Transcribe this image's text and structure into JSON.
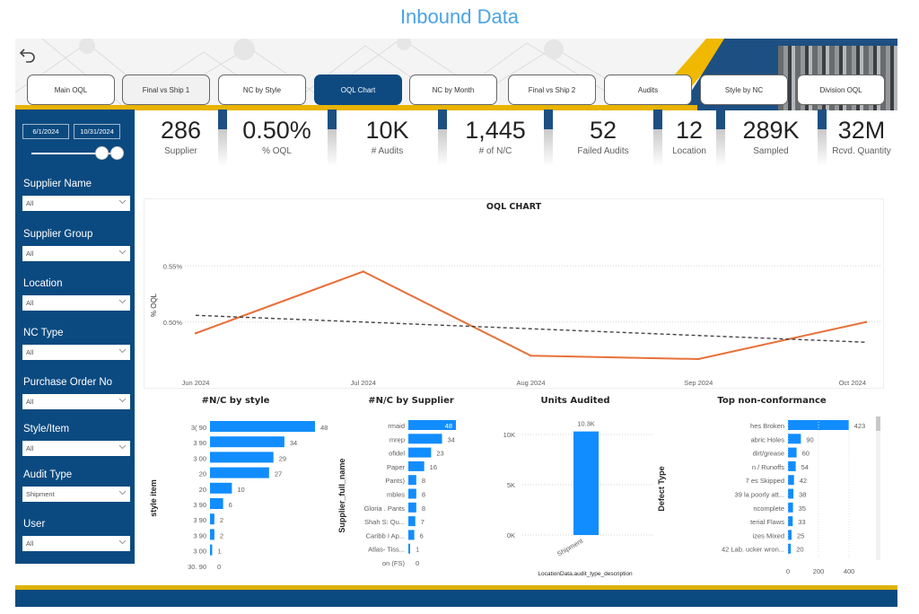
{
  "page": {
    "title": "Inbound Data"
  },
  "nav": {
    "back_icon": "undo-arrow-icon",
    "tabs": [
      {
        "label": "Main OQL",
        "state": "normal"
      },
      {
        "label": "Final vs Ship 1",
        "state": "alt"
      },
      {
        "label": "NC by Style",
        "state": "normal"
      },
      {
        "label": "OQL Chart",
        "state": "active"
      },
      {
        "label": "NC by Month",
        "state": "normal"
      },
      {
        "label": "Final vs Ship 2",
        "state": "normal"
      },
      {
        "label": "Audits",
        "state": "normal"
      },
      {
        "label": "Style by NC",
        "state": "normal"
      },
      {
        "label": "Division OQL",
        "state": "normal"
      }
    ]
  },
  "sidebar": {
    "date_range": {
      "start": "6/1/2024",
      "end": "10/31/2024"
    },
    "filters": [
      {
        "label": "Supplier Name",
        "value": "All"
      },
      {
        "label": "Supplier Group",
        "value": "All"
      },
      {
        "label": "Location",
        "value": "All"
      },
      {
        "label": "NC Type",
        "value": "All"
      },
      {
        "label": "Purchase Order No",
        "value": "All"
      },
      {
        "label": "Style/Item",
        "value": "All"
      },
      {
        "label": "Audit Type",
        "value": "Shipment"
      },
      {
        "label": "User",
        "value": "All"
      }
    ]
  },
  "kpis": [
    {
      "value": "286",
      "label": "Supplier"
    },
    {
      "value": "0.50%",
      "label": "% OQL"
    },
    {
      "value": "10K",
      "label": "# Audits"
    },
    {
      "value": "1,445",
      "label": "# of N/C"
    },
    {
      "value": "52",
      "label": "Failed Audits"
    },
    {
      "value": "12",
      "label": "Location"
    },
    {
      "value": "289K",
      "label": "Sampled"
    },
    {
      "value": "32M",
      "label": "Rcvd. Quantity"
    }
  ],
  "colors": {
    "accent_blue": "#0b4a80",
    "bar_blue": "#118dff",
    "line_orange": "#e8703a",
    "title_blue": "#4aa3e6",
    "yellow": "#e9b300"
  },
  "chart_data": [
    {
      "type": "line",
      "title": "OQL CHART",
      "xlabel": "",
      "ylabel": "% OQL",
      "categories": [
        "Jun 2024",
        "Jul 2024",
        "Aug 2024",
        "Sep 2024",
        "Oct 2024"
      ],
      "series": [
        {
          "name": "% OQL",
          "values": [
            0.49,
            0.545,
            0.47,
            0.467,
            0.5
          ]
        },
        {
          "name": "Trend",
          "style": "dashed",
          "values": [
            0.506,
            0.5,
            0.494,
            0.488,
            0.482
          ]
        }
      ],
      "yticks": [
        "0.55%",
        "0.50%"
      ],
      "ytick_values": [
        0.55,
        0.5
      ],
      "ylim": [
        0.455,
        0.575
      ],
      "grid": true
    },
    {
      "type": "bar",
      "orientation": "horizontal",
      "title": "#N/C by style",
      "ylabel": "style item",
      "categories": [
        "3( 90",
        "3 90",
        "3 00",
        "20",
        "20",
        "3 90",
        "3 90",
        "3 90",
        "3 00",
        "30. 90"
      ],
      "values": [
        48,
        34,
        29,
        27,
        10,
        6,
        2,
        2,
        1,
        0
      ],
      "xlim": [
        0,
        48
      ]
    },
    {
      "type": "bar",
      "orientation": "horizontal",
      "title": "#N/C by Supplier",
      "ylabel": "Supplier_full_name",
      "categories": [
        "rmaid",
        "mrep",
        "ofidel",
        "Paper",
        "Pants)",
        "mbles",
        "Gloria . Pants",
        "Shah S: Qu...",
        "Caribb I Ap...",
        "Atlas- Tiss...",
        "on (FS)"
      ],
      "values": [
        48,
        34,
        23,
        16,
        8,
        8,
        8,
        7,
        6,
        1,
        0
      ],
      "xlim": [
        0,
        48
      ]
    },
    {
      "type": "bar",
      "orientation": "vertical",
      "title": "Units Audited",
      "xlabel": "LocationData.audit_type_description",
      "categories": [
        "Shipment"
      ],
      "values": [
        10300
      ],
      "data_labels": [
        "10.3K"
      ],
      "yticks": [
        "0K",
        "5K",
        "10K"
      ],
      "ylim": [
        0,
        10000
      ],
      "grid": true
    },
    {
      "type": "bar",
      "orientation": "horizontal",
      "title": "Top non-conformance",
      "ylabel": "Defect Type",
      "categories": [
        "hes Broken",
        "abric Holes",
        "dirt/grease",
        "n / Runoffs",
        "7 es Skipped",
        "39 la poorly att...",
        "ncomplete",
        "terial Flaws",
        "izes Mixed",
        "42 Lab. ucker wron..."
      ],
      "values": [
        423,
        90,
        60,
        54,
        42,
        38,
        35,
        33,
        25,
        20
      ],
      "xticks": [
        "0",
        "200",
        "400"
      ],
      "xlim": [
        0,
        450
      ]
    }
  ]
}
